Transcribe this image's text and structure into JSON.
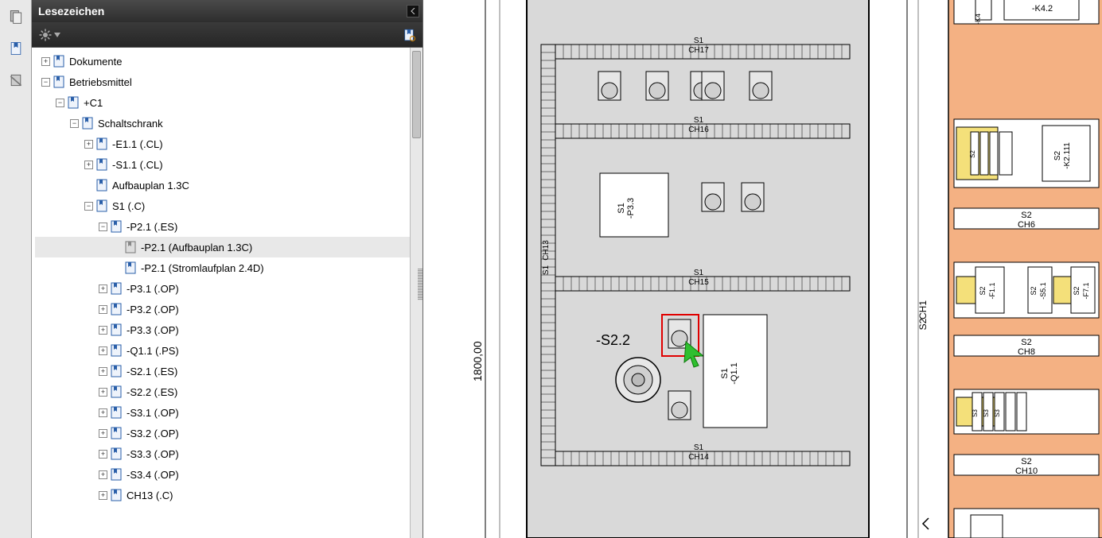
{
  "sidebar": {
    "title": "Lesezeichen",
    "tree": [
      {
        "id": "dokumente",
        "label": "Dokumente",
        "level": 0,
        "toggle": "plus",
        "icon": "doc"
      },
      {
        "id": "betriebsmittel",
        "label": "Betriebsmittel",
        "level": 0,
        "toggle": "minus",
        "icon": "doc"
      },
      {
        "id": "c1",
        "label": "+C1",
        "level": 1,
        "toggle": "minus",
        "icon": "doc"
      },
      {
        "id": "schaltschrank",
        "label": "Schaltschrank",
        "level": 2,
        "toggle": "minus",
        "icon": "doc"
      },
      {
        "id": "e11",
        "label": "-E1.1  (.CL)",
        "level": 3,
        "toggle": "plus",
        "icon": "doc"
      },
      {
        "id": "s11",
        "label": "-S1.1  (.CL)",
        "level": 3,
        "toggle": "plus",
        "icon": "doc"
      },
      {
        "id": "aufbau",
        "label": "Aufbauplan 1.3C",
        "level": 3,
        "toggle": "none",
        "icon": "doc"
      },
      {
        "id": "s1",
        "label": "S1  (.C)",
        "level": 3,
        "toggle": "minus",
        "icon": "doc"
      },
      {
        "id": "p21",
        "label": "-P2.1  (.ES)",
        "level": 4,
        "toggle": "minus",
        "icon": "doc"
      },
      {
        "id": "p21a",
        "label": "-P2.1 (Aufbauplan 1.3C)",
        "level": 5,
        "toggle": "none",
        "icon": "doc-grey",
        "selected": true
      },
      {
        "id": "p21s",
        "label": "-P2.1 (Stromlaufplan 2.4D)",
        "level": 5,
        "toggle": "none",
        "icon": "doc"
      },
      {
        "id": "p31",
        "label": "-P3.1  (.OP)",
        "level": 4,
        "toggle": "plus",
        "icon": "doc"
      },
      {
        "id": "p32",
        "label": "-P3.2  (.OP)",
        "level": 4,
        "toggle": "plus",
        "icon": "doc"
      },
      {
        "id": "p33",
        "label": "-P3.3  (.OP)",
        "level": 4,
        "toggle": "plus",
        "icon": "doc"
      },
      {
        "id": "q11",
        "label": "-Q1.1  (.PS)",
        "level": 4,
        "toggle": "plus",
        "icon": "doc"
      },
      {
        "id": "s21",
        "label": "-S2.1  (.ES)",
        "level": 4,
        "toggle": "plus",
        "icon": "doc"
      },
      {
        "id": "s22",
        "label": "-S2.2  (.ES)",
        "level": 4,
        "toggle": "plus",
        "icon": "doc"
      },
      {
        "id": "s31",
        "label": "-S3.1  (.OP)",
        "level": 4,
        "toggle": "plus",
        "icon": "doc"
      },
      {
        "id": "s32",
        "label": "-S3.2  (.OP)",
        "level": 4,
        "toggle": "plus",
        "icon": "doc"
      },
      {
        "id": "s33",
        "label": "-S3.3  (.OP)",
        "level": 4,
        "toggle": "plus",
        "icon": "doc"
      },
      {
        "id": "s34",
        "label": "-S3.4  (.OP)",
        "level": 4,
        "toggle": "plus",
        "icon": "doc"
      },
      {
        "id": "ch13",
        "label": "CH13  (.C)",
        "level": 4,
        "toggle": "plus",
        "icon": "doc"
      }
    ]
  },
  "drawing": {
    "dim_label": "1800,00",
    "cabinet": {
      "rail_ch17": "CH17",
      "rail_ch16": "CH16",
      "rail_ch15": "CH15",
      "rail_ch14": "CH14",
      "rail_prefix": "S1",
      "vertical_rail": "CH13",
      "box_p33_top": "S1",
      "box_p33_bottom": "-P3.3",
      "box_q11_top": "S1",
      "box_q11_bottom": "-Q1.1",
      "label_s22": "-S2.2"
    },
    "right_panel": {
      "block_k42": "-K4.2",
      "block_k4": "-K4",
      "s2_k2111_a": "S2",
      "s2_k2111_b": "-K2.111",
      "tb_s2": "S2",
      "ch6": "CH6",
      "s2_f11_a": "S2",
      "s2_f11_b": "-F1.1",
      "s2_s51_a": "S2",
      "s2_s51_b": "-S5.1",
      "s2_f71_a": "S2",
      "s2_f71_b": "-F7.1",
      "side_s2": "S2",
      "side_ch1": "CH1",
      "ch8": "CH8",
      "ch10": "CH10",
      "tb_s3": "S3"
    }
  }
}
